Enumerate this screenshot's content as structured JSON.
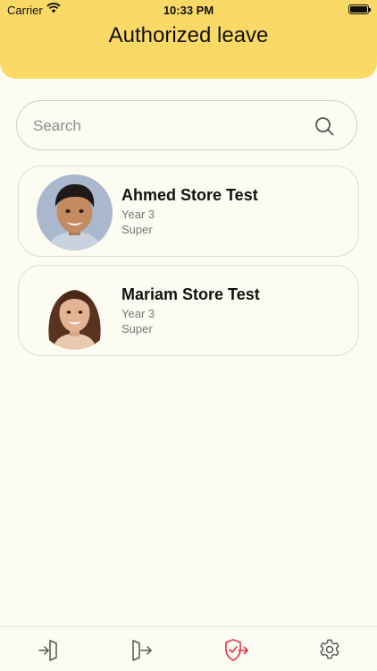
{
  "status_bar": {
    "carrier": "Carrier",
    "time": "10:33 PM"
  },
  "header": {
    "title": "Authorized leave"
  },
  "search": {
    "placeholder": "Search"
  },
  "students": [
    {
      "name": "Ahmed Store Test",
      "year": "Year 3",
      "level": "Super"
    },
    {
      "name": "Mariam Store Test",
      "year": "Year 3",
      "level": "Super"
    }
  ],
  "tabbar": {
    "tabs": [
      {
        "icon": "entry-icon",
        "active": false
      },
      {
        "icon": "exit-icon",
        "active": false
      },
      {
        "icon": "authorized-leave-icon",
        "active": true
      },
      {
        "icon": "gear-icon",
        "active": false
      }
    ],
    "active_color": "#e0344a",
    "inactive_color": "#555555"
  },
  "colors": {
    "header_bg": "#fbd967",
    "page_bg": "#fdfcf3"
  }
}
